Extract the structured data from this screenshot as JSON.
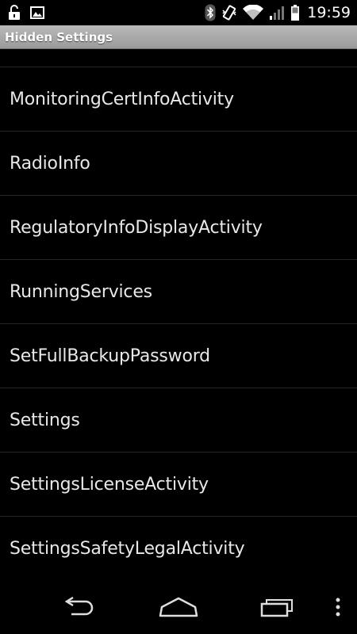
{
  "status_bar": {
    "time": "19:59",
    "icons": [
      "unlock-icon",
      "image-icon",
      "bluetooth-icon",
      "vibrate-icon",
      "wifi-icon",
      "signal-icon",
      "battery-icon"
    ]
  },
  "action_bar": {
    "title": "Hidden Settings"
  },
  "list": {
    "items": [
      {
        "label": "MonitoringCertInfoActivity"
      },
      {
        "label": "RadioInfo"
      },
      {
        "label": "RegulatoryInfoDisplayActivity"
      },
      {
        "label": "RunningServices"
      },
      {
        "label": "SetFullBackupPassword"
      },
      {
        "label": "Settings"
      },
      {
        "label": "SettingsLicenseActivity"
      },
      {
        "label": "SettingsSafetyLegalActivity"
      }
    ]
  },
  "nav_bar": {
    "icons": [
      "back-icon",
      "home-icon",
      "recent-apps-icon",
      "overflow-menu-icon"
    ]
  },
  "colors": {
    "background": "#000000",
    "text": "#e8e8e8",
    "action_bar": "#a8a8a8",
    "divider": "#262626"
  }
}
